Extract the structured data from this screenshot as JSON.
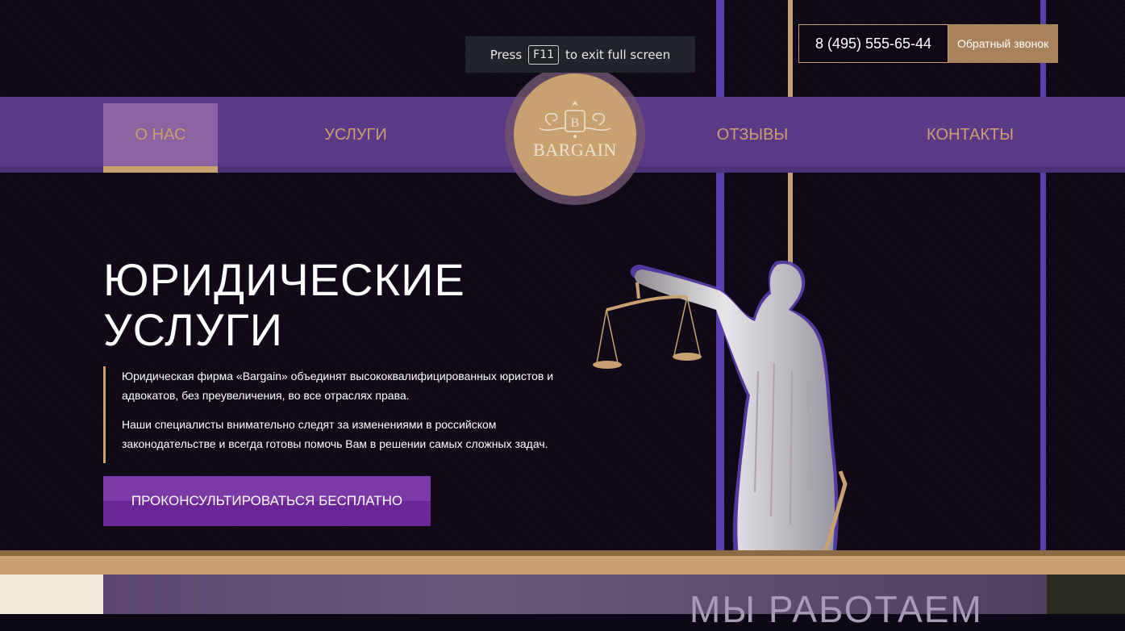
{
  "fullscreen_toast": {
    "press": "Press",
    "key": "F11",
    "rest": "to exit full screen"
  },
  "header": {
    "phone": "8 (495) 555-65-44",
    "callback": "Обратный звонок"
  },
  "nav": {
    "items": [
      {
        "label": "О НАС",
        "active": true
      },
      {
        "label": "УСЛУГИ",
        "active": false
      },
      {
        "label": "ОТЗЫВЫ",
        "active": false
      },
      {
        "label": "КОНТАКТЫ",
        "active": false
      }
    ]
  },
  "logo": {
    "monogram": "B",
    "text": "BARGAIN"
  },
  "hero": {
    "title_line1": "ЮРИДИЧЕСКИЕ",
    "title_line2": "УСЛУГИ",
    "paragraph1": "Юридическая фирма «Bargain» объединят высококвалифицированных юристов и адвокатов, без преувеличения, во все отраслях права.",
    "paragraph2": "Наши специалисты внимательно следят за изменениями в российском законодательстве и всегда готовы помочь Вам в решении самых сложных задач.",
    "cta": "ПРОКОНСУЛЬТИРОВАТЬСЯ БЕСПЛАТНО"
  },
  "next_section": {
    "title": "МЫ РАБОТАЕМ"
  },
  "colors": {
    "gold": "#c9a070",
    "purple_nav": "#5a3a87",
    "purple_line": "#5b3fae",
    "cta_purple": "#7c3aa6",
    "background": "#0d0716"
  }
}
